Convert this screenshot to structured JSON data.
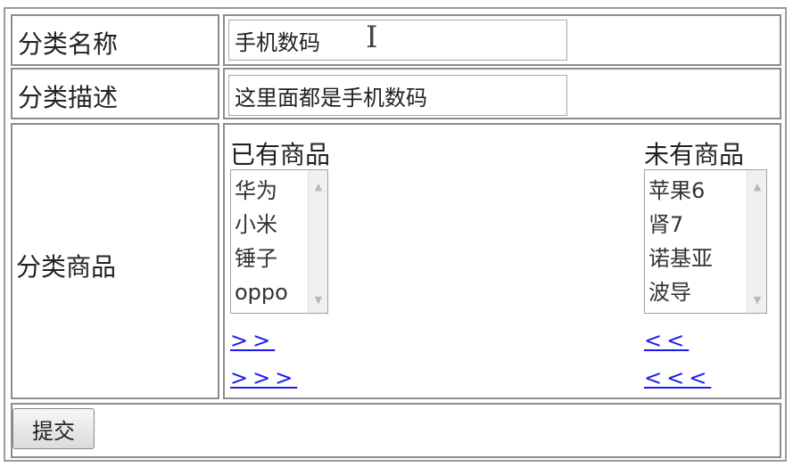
{
  "form": {
    "name_row": {
      "label": "分类名称",
      "value": "手机数码",
      "cursor_glyph": "I"
    },
    "desc_row": {
      "label": "分类描述",
      "value": "这里面都是手机数码"
    },
    "products_row": {
      "label": "分类商品",
      "existing": {
        "heading": "已有商品",
        "items": [
          "华为",
          "小米",
          "锤子",
          "oppo"
        ]
      },
      "available": {
        "heading": "未有商品",
        "items": [
          "苹果6",
          "肾7",
          "诺基亚",
          "波导"
        ]
      },
      "move_one_right": ">>",
      "move_all_right": ">>>",
      "move_one_left": "<<",
      "move_all_left": "<<<"
    },
    "submit_label": "提交"
  },
  "icons": {
    "scroll_up": "scroll-up-icon",
    "scroll_down": "scroll-down-icon",
    "text_cursor": "text-cursor-icon"
  },
  "colors": {
    "link": "#1a1aee",
    "border": "#8c8c8c"
  }
}
